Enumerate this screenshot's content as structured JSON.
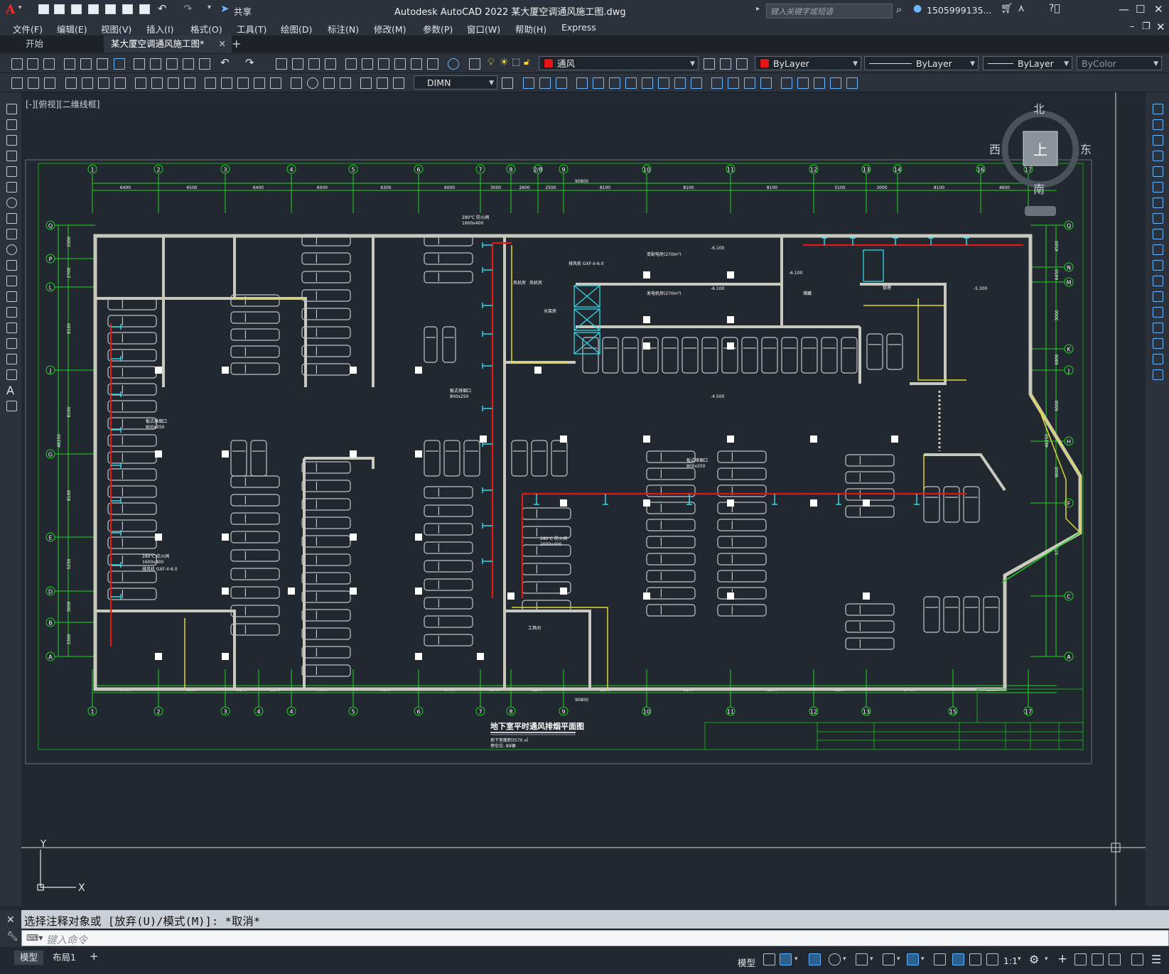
{
  "window": {
    "app_logo": "A",
    "share_label": "共享",
    "title": "Autodesk AutoCAD 2022    某大厦空调通风施工图.dwg",
    "search_placeholder": "键入关键字或短语",
    "user": "1505999135...",
    "minimize": "—",
    "maximize": "☐",
    "close": "✕"
  },
  "menu": [
    "文件(F)",
    "编辑(E)",
    "视图(V)",
    "插入(I)",
    "格式(O)",
    "工具(T)",
    "绘图(D)",
    "标注(N)",
    "修改(M)",
    "参数(P)",
    "窗口(W)",
    "帮助(H)",
    "Express"
  ],
  "tabs": {
    "start": "开始",
    "drawing": "某大厦空调通风施工图*",
    "close": "✕",
    "add": "+"
  },
  "toolbar": {
    "layer": "通风",
    "color": "ByLayer",
    "linetype": "ByLayer",
    "lineweight": "ByLayer",
    "plotstyle": "ByColor",
    "dimstyle": "DIMN",
    "layer_color": "#e8141c"
  },
  "viewport": {
    "label": "[-][俯视][二维线框]",
    "viewcube": {
      "north": "北",
      "south": "南",
      "east": "东",
      "west": "西",
      "top": "上"
    },
    "ucs_x": "X",
    "ucs_y": "Y"
  },
  "drawing": {
    "title": "地下室平时通风排烟平面图",
    "note1": "地下室面积3570 ㎡",
    "note2": "停车位: 89辆",
    "column_axes_top": [
      "1",
      "2",
      "3",
      "4",
      "5",
      "6",
      "7",
      "8",
      "2/8",
      "9",
      "10",
      "11",
      "12",
      "13",
      "14",
      "16",
      "17"
    ],
    "column_axes_bottom": [
      "1",
      "2",
      "3",
      "4",
      "4",
      "5",
      "6",
      "7",
      "8",
      "9",
      "10",
      "11",
      "12",
      "13",
      "15",
      "17"
    ],
    "row_axes_left": [
      "Q",
      "P",
      "L",
      "J",
      "G",
      "E",
      "D",
      "B",
      "A"
    ],
    "row_axes_right": [
      "Q",
      "N",
      "M",
      "K",
      "J",
      "H",
      "F",
      "C",
      "A"
    ],
    "top_dims": [
      "6400",
      "6500",
      "6400",
      "6000",
      "6300",
      "6000",
      "3000",
      "2600",
      "2500",
      "8100",
      "8100",
      "8100",
      "5100",
      "3000",
      "8100",
      "4600"
    ],
    "top_total": "90800",
    "bottom_dims": [
      "6400",
      "6500",
      "3200",
      "3200",
      "6000",
      "6300",
      "6000",
      "3000",
      "5100",
      "8100",
      "8100",
      "8100",
      "5100",
      "3400",
      "7300"
    ],
    "bottom_total": "90800",
    "left_dims": [
      "3300",
      "2700",
      "8100",
      "8100",
      "8100",
      "5250",
      "3000",
      "3300"
    ],
    "left_total": "48250",
    "right_dims": [
      "4500",
      "6450",
      "3000",
      "6900",
      "6000",
      "9000",
      "5750"
    ],
    "right_total": "48250",
    "elevations": [
      "-6.100",
      "-6.100",
      "-6.100",
      "-4.500",
      "-5.300"
    ],
    "labels": {
      "fan1": "280℃ 防火阀",
      "fan1_size": "1600x400",
      "fan2": "排风机 GXF-II-6.0",
      "fan3": "280℃ 防火阀",
      "fan3_size": "1600x400",
      "fan4": "排风机 GXF-II-6.0",
      "grille1": "板式排烟口",
      "grille1_size": "800x250",
      "grille2": "板式排烟口",
      "grille2_size": "800x250",
      "grille3": "板式排烟口",
      "grille3_size": "800x250",
      "fan5": "280℃ 防火阀",
      "fan5_size": "2000x400",
      "room1": "变配电房(270m²)",
      "room2": "发电机房(270m²)",
      "room3": "水泵房",
      "room4": "风机房",
      "room5": "风机房",
      "room6": "储藏",
      "room7": "管理",
      "room8": "工具间"
    }
  },
  "command": {
    "history": "选择注释对象或 [放弃(U)/模式(M)]: *取消*",
    "placeholder": "键入命令"
  },
  "status": {
    "model_tab": "模型",
    "layout_tab": "布局1",
    "add": "+",
    "model_btn": "模型",
    "scale": "1:1"
  },
  "colors": {
    "grid_green": "#1fd41f",
    "duct_red": "#e11818",
    "wall_gray": "#c9c9bd",
    "cyan": "#33d6e6",
    "yellow": "#e0d836"
  }
}
